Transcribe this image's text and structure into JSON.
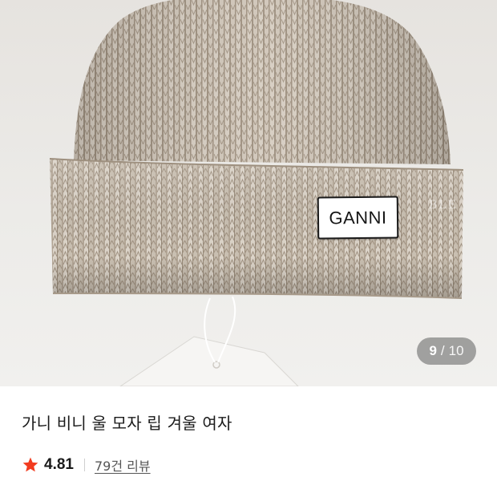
{
  "gallery": {
    "brand_label": "GANNI",
    "current": "9",
    "separator": "/",
    "total": "10"
  },
  "product": {
    "title": "가니 비니 울 모자 립 겨울 여자",
    "rating": "4.81",
    "review_link": "79건 리뷰"
  },
  "colors": {
    "star": "#f23b1f",
    "knit": "#b5a899",
    "knit_light": "#d8d0c5",
    "background": "#ecebe8"
  },
  "icons": {
    "rating": "star-icon"
  }
}
